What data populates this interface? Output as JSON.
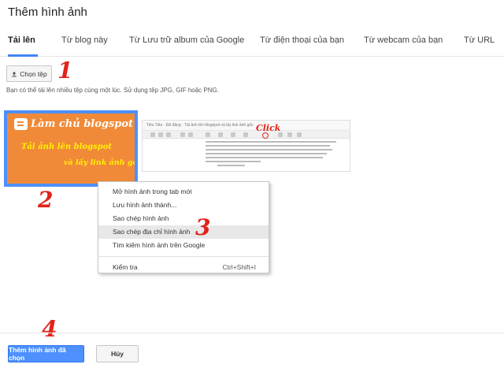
{
  "dialog": {
    "title": "Thêm hình ảnh"
  },
  "tabs": [
    {
      "label": "Tải lên",
      "active": true
    },
    {
      "label": "Từ blog này"
    },
    {
      "label": "Từ Lưu trữ album của Google"
    },
    {
      "label": "Từ điện thoại của bạn"
    },
    {
      "label": "Từ webcam của bạn"
    },
    {
      "label": "Từ URL"
    }
  ],
  "upload": {
    "button_label": "Chọn tệp",
    "hint": "Bạn có thể tải lên nhiều tệp cùng một lúc. Sử dụng tệp JPG, GIF hoặc PNG."
  },
  "thumbnails": {
    "selected": {
      "line1": "Làm chủ blogspot",
      "line2": "Tải ảnh lên blogspot",
      "line3": "và lấy link ảnh gốc"
    },
    "second": {
      "toolbar_text": "Tiêu Tiêu · Đã đăng · Tải ảnh lên blogspot và lấy link ảnh gốc"
    }
  },
  "annotations": {
    "step1": "1",
    "step2": "2",
    "step3": "3",
    "step4": "4",
    "click": "Click"
  },
  "context_menu": {
    "items": [
      {
        "label": "Mở hình ảnh trong tab mới"
      },
      {
        "label": "Lưu hình ảnh thành..."
      },
      {
        "label": "Sao chép hình ảnh"
      },
      {
        "label": "Sao chép địa chỉ hình ảnh",
        "highlighted": true
      },
      {
        "label": "Tìm kiếm hình ảnh trên Google"
      },
      {
        "label": "Kiểm tra",
        "shortcut": "Ctrl+Shift+I"
      }
    ]
  },
  "footer": {
    "primary_label": "Thêm hình ảnh đã chọn",
    "cancel_label": "Hủy"
  },
  "colors": {
    "accent": "#4d90fe",
    "annotation": "#e2231a",
    "thumbnail_bg": "#f08a38"
  }
}
